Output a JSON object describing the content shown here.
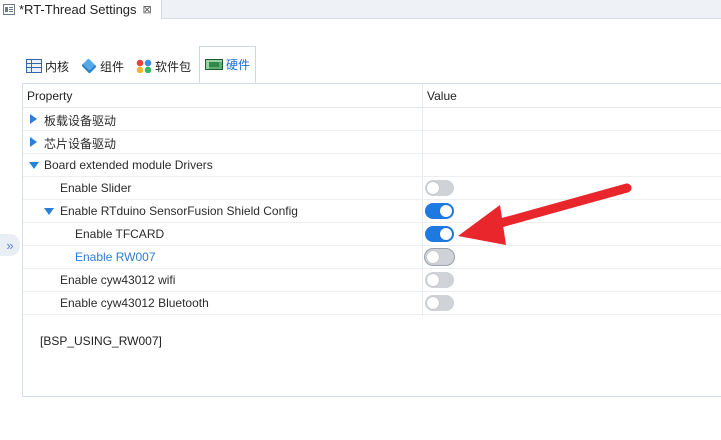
{
  "window": {
    "tab_title": "*RT-Thread Settings",
    "close_glyph": "⊠"
  },
  "category_tabs": [
    {
      "label": "内核",
      "icon": "grid-icon",
      "active": false
    },
    {
      "label": "组件",
      "icon": "cube-icon",
      "active": false
    },
    {
      "label": "软件包",
      "icon": "package-icon",
      "active": false
    },
    {
      "label": "硬件",
      "icon": "board-icon",
      "active": true
    }
  ],
  "grid": {
    "header_property": "Property",
    "header_value": "Value",
    "rows": [
      {
        "label": "板载设备驱动",
        "expander": "collapsed",
        "has_toggle": false
      },
      {
        "label": "芯片设备驱动",
        "expander": "collapsed",
        "has_toggle": false
      },
      {
        "label": "Board extended module Drivers",
        "expander": "expanded",
        "has_toggle": false
      },
      {
        "label": "Enable Slider",
        "expander": "none",
        "has_toggle": true,
        "value": "off"
      },
      {
        "label": "Enable RTduino SensorFusion Shield Config",
        "expander": "expanded",
        "has_toggle": true,
        "value": "on"
      },
      {
        "label": "Enable TFCARD",
        "expander": "none",
        "has_toggle": true,
        "value": "on"
      },
      {
        "label": "Enable RW007",
        "expander": "none",
        "has_toggle": true,
        "value": "off",
        "selected": true
      },
      {
        "label": "Enable cyw43012 wifi",
        "expander": "none",
        "has_toggle": true,
        "value": "off"
      },
      {
        "label": "Enable cyw43012 Bluetooth",
        "expander": "none",
        "has_toggle": true,
        "value": "off"
      }
    ]
  },
  "description": "[BSP_USING_RW007]",
  "collapse_handle": "»",
  "colors": {
    "accent": "#1e7ae0",
    "link": "#2f7bd6",
    "annotation_arrow": "#e8262b"
  }
}
